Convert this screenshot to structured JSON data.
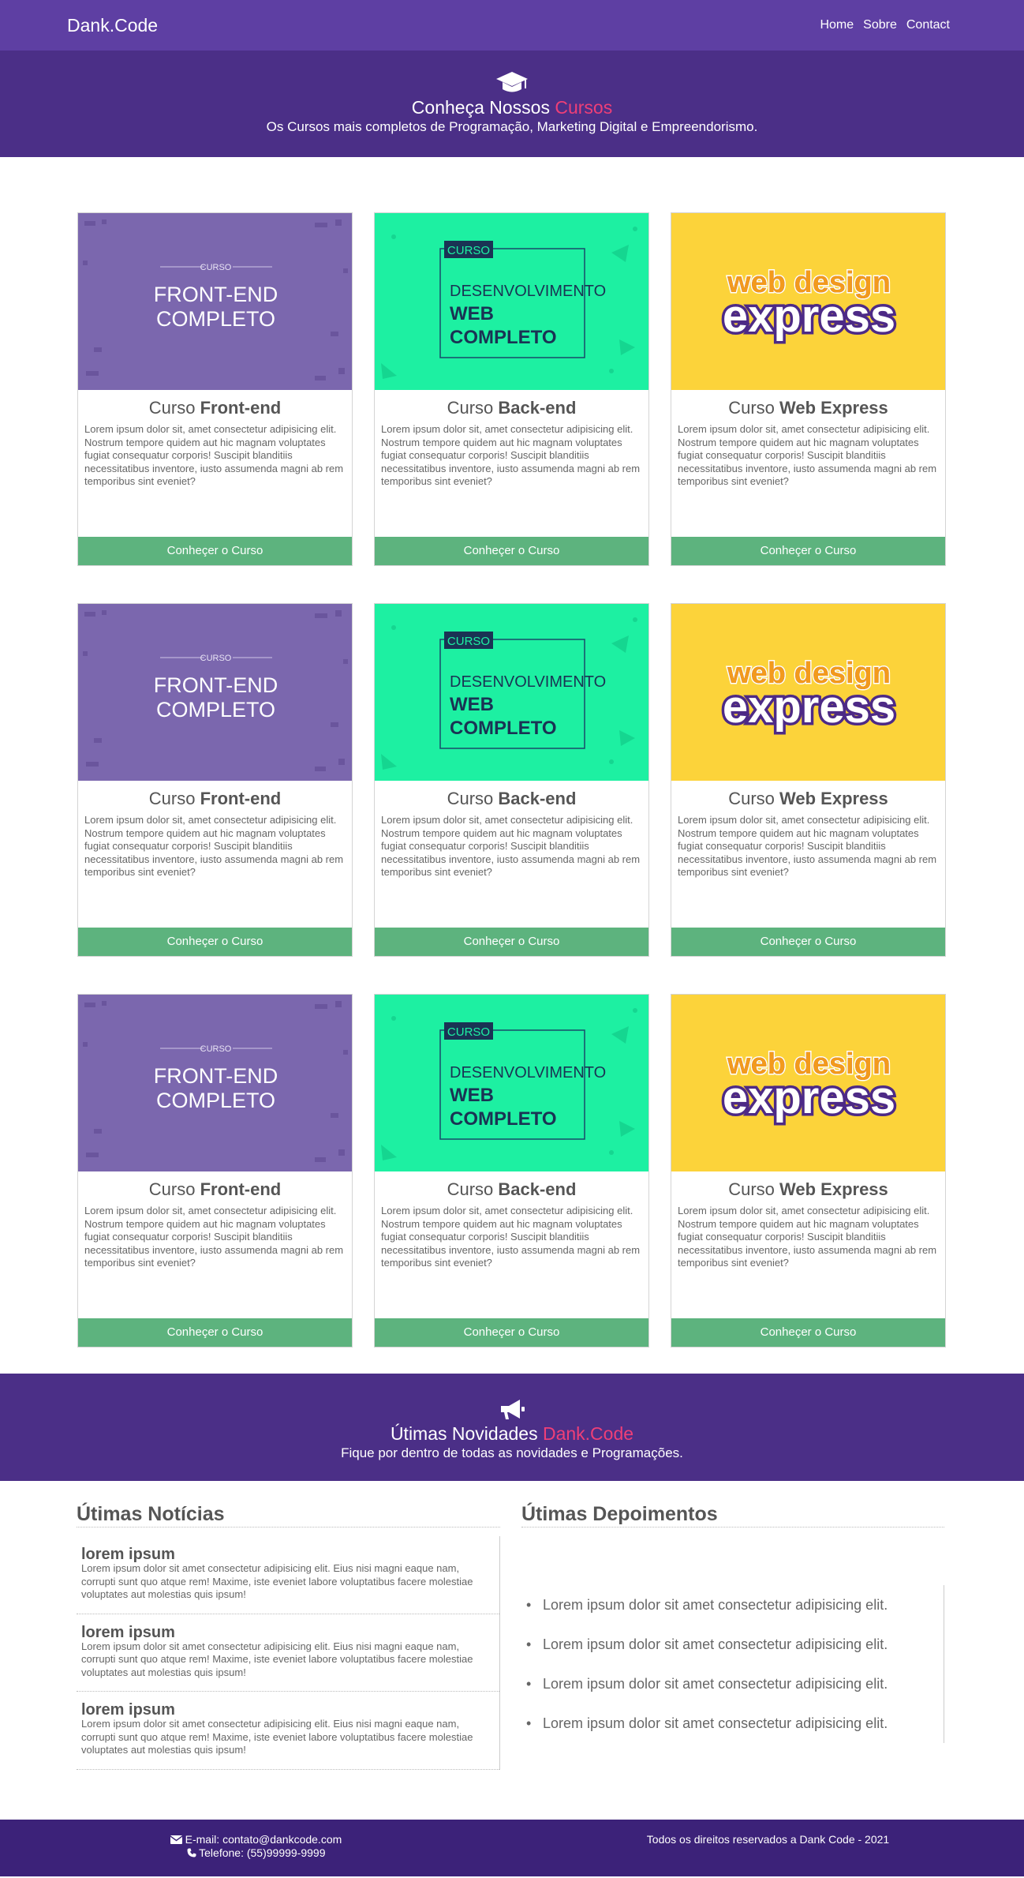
{
  "navbar": {
    "brand": "Dank.Code",
    "links": [
      "Home",
      "Sobre",
      "Contact"
    ]
  },
  "hero": {
    "icon": "graduation-cap-icon",
    "title_prefix": "Conheça Nossos ",
    "title_accent": "Cursos",
    "subtitle": "Os Cursos mais completos de Programação, Marketing Digital e Empreendorismo."
  },
  "courses": {
    "rows": [
      [
        {
          "title_plain": "Curso ",
          "title_bold": "Front-end",
          "desc": "Lorem ipsum dolor sit, amet consectetur adipisicing elit. Nostrum tempore quidem aut hic magnam voluptates fugiat consequatur corporis! Suscipit blanditiis necessitatibus inventore, iusto assumenda magni ab rem temporibus sint eveniet?",
          "button": "Conheçer o Curso"
        },
        {
          "title_plain": "Curso ",
          "title_bold": "Back-end",
          "desc": "Lorem ipsum dolor sit, amet consectetur adipisicing elit. Nostrum tempore quidem aut hic magnam voluptates fugiat consequatur corporis! Suscipit blanditiis necessitatibus inventore, iusto assumenda magni ab rem temporibus sint eveniet?",
          "button": "Conheçer o Curso"
        },
        {
          "title_plain": "Curso ",
          "title_bold": "Web Express",
          "desc": "Lorem ipsum dolor sit, amet consectetur adipisicing elit. Nostrum tempore quidem aut hic magnam voluptates fugiat consequatur corporis! Suscipit blanditiis necessitatibus inventore, iusto assumenda magni ab rem temporibus sint eveniet?",
          "button": "Conheçer o Curso"
        }
      ],
      [
        {
          "title_plain": "Curso ",
          "title_bold": "Front-end",
          "desc": "Lorem ipsum dolor sit, amet consectetur adipisicing elit. Nostrum tempore quidem aut hic magnam voluptates fugiat consequatur corporis! Suscipit blanditiis necessitatibus inventore, iusto assumenda magni ab rem temporibus sint eveniet?",
          "button": "Conheçer o Curso"
        },
        {
          "title_plain": "Curso ",
          "title_bold": "Back-end",
          "desc": "Lorem ipsum dolor sit, amet consectetur adipisicing elit. Nostrum tempore quidem aut hic magnam voluptates fugiat consequatur corporis! Suscipit blanditiis necessitatibus inventore, iusto assumenda magni ab rem temporibus sint eveniet?",
          "button": "Conheçer o Curso"
        },
        {
          "title_plain": "Curso ",
          "title_bold": "Web Express",
          "desc": "Lorem ipsum dolor sit, amet consectetur adipisicing elit. Nostrum tempore quidem aut hic magnam voluptates fugiat consequatur corporis! Suscipit blanditiis necessitatibus inventore, iusto assumenda magni ab rem temporibus sint eveniet?",
          "button": "Conheçer o Curso"
        }
      ],
      [
        {
          "title_plain": "Curso ",
          "title_bold": "Front-end",
          "desc": "Lorem ipsum dolor sit, amet consectetur adipisicing elit. Nostrum tempore quidem aut hic magnam voluptates fugiat consequatur corporis! Suscipit blanditiis necessitatibus inventore, iusto assumenda magni ab rem temporibus sint eveniet?",
          "button": "Conheçer o Curso"
        },
        {
          "title_plain": "Curso ",
          "title_bold": "Back-end",
          "desc": "Lorem ipsum dolor sit, amet consectetur adipisicing elit. Nostrum tempore quidem aut hic magnam voluptates fugiat consequatur corporis! Suscipit blanditiis necessitatibus inventore, iusto assumenda magni ab rem temporibus sint eveniet?",
          "button": "Conheçer o Curso"
        },
        {
          "title_plain": "Curso ",
          "title_bold": "Web Express",
          "desc": "Lorem ipsum dolor sit, amet consectetur adipisicing elit. Nostrum tempore quidem aut hic magnam voluptates fugiat consequatur corporis! Suscipit blanditiis necessitatibus inventore, iusto assumenda magni ab rem temporibus sint eveniet?",
          "button": "Conheçer o Curso"
        }
      ]
    ],
    "thumbs": {
      "front": {
        "small": "CURSO",
        "line1": "FRONT-END",
        "line2": "COMPLETO"
      },
      "back": {
        "tag": "CURSO",
        "line1": "DESENVOLVIMENTO",
        "line2": "WEB",
        "line3": "COMPLETO"
      },
      "web": {
        "line1": "web design",
        "line2": "express"
      }
    },
    "colors": {
      "front": "#7b67ae",
      "back": "#1df0a2",
      "web": "#fcd33a",
      "button": "#5db37e"
    }
  },
  "news_band": {
    "icon": "megaphone-icon",
    "title_prefix": "Útimas Novidades ",
    "title_accent": "Dank.Code",
    "subtitle": "Fique por dentro de todas as novidades e Programações."
  },
  "news": {
    "title": "Útimas Notícias",
    "items": [
      {
        "heading": "lorem ipsum",
        "text": "Lorem ipsum dolor sit amet consectetur adipisicing elit. Eius nisi magni eaque nam, corrupti sunt quo atque rem! Maxime, iste eveniet labore voluptatibus facere molestiae voluptates aut molestias quis ipsum!"
      },
      {
        "heading": "lorem ipsum",
        "text": "Lorem ipsum dolor sit amet consectetur adipisicing elit. Eius nisi magni eaque nam, corrupti sunt quo atque rem! Maxime, iste eveniet labore voluptatibus facere molestiae voluptates aut molestias quis ipsum!"
      },
      {
        "heading": "lorem ipsum",
        "text": "Lorem ipsum dolor sit amet consectetur adipisicing elit. Eius nisi magni eaque nam, corrupti sunt quo atque rem! Maxime, iste eveniet labore voluptatibus facere molestiae voluptates aut molestias quis ipsum!"
      }
    ]
  },
  "testimonials": {
    "title": "Útimas Depoimentos",
    "items": [
      "Lorem ipsum dolor sit amet consectetur adipisicing elit.",
      "Lorem ipsum dolor sit amet consectetur adipisicing elit.",
      "Lorem ipsum dolor sit amet consectetur adipisicing elit.",
      "Lorem ipsum dolor sit amet consectetur adipisicing elit."
    ]
  },
  "footer": {
    "email": "E-mail: contato@dankcode.com",
    "phone": "Telefone: (55)99999-9999",
    "rights": "Todos os direitos reservados a Dank Code - 2021",
    "email_icon": "envelope-icon",
    "phone_icon": "phone-icon"
  }
}
